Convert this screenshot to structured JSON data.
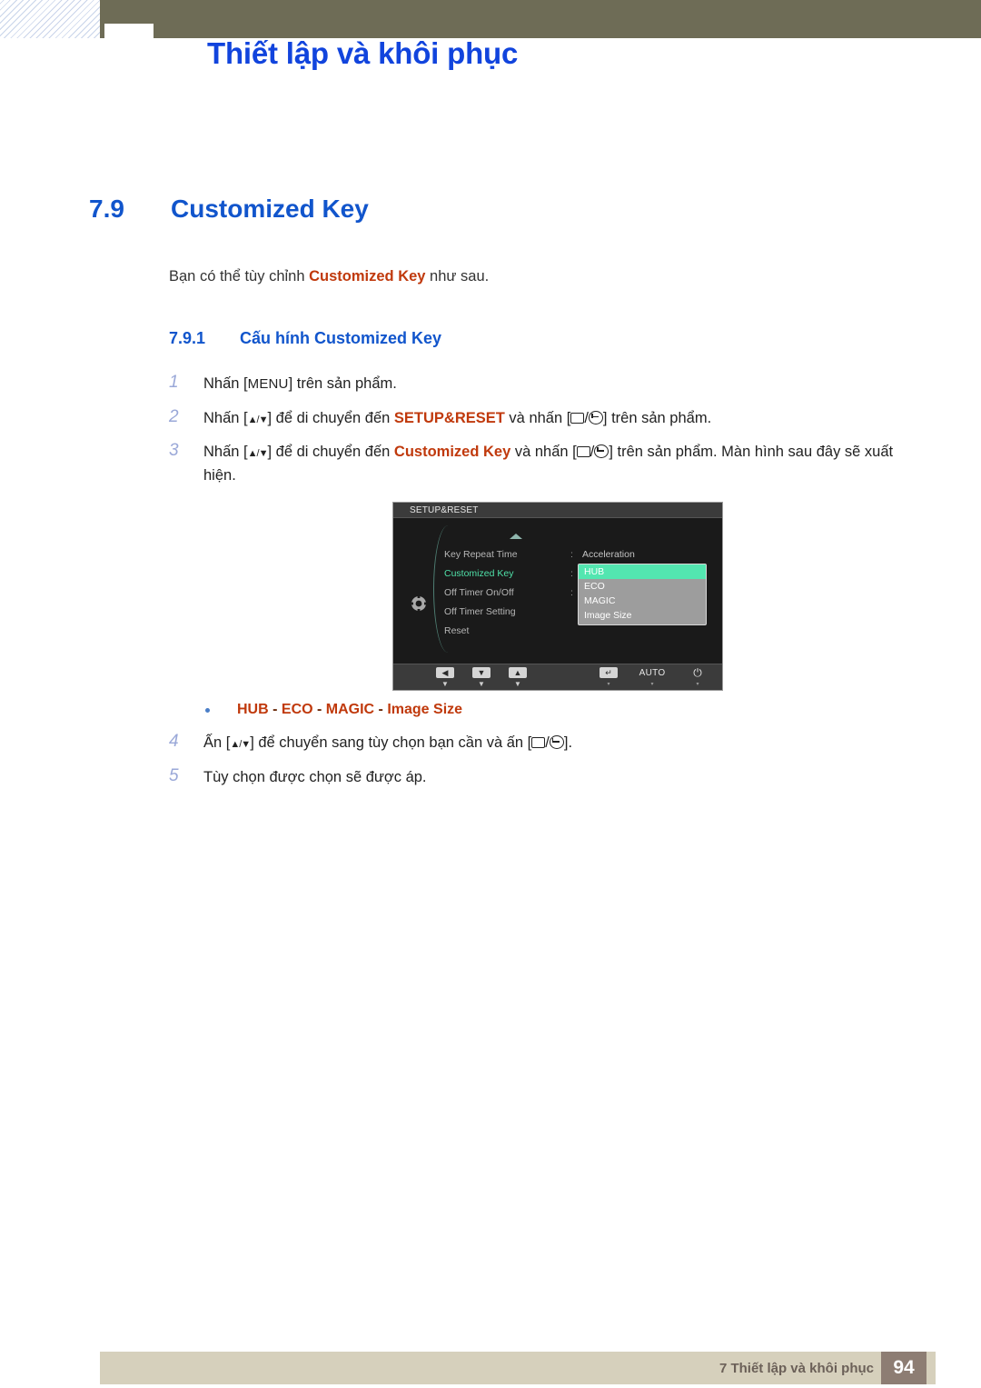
{
  "header": {
    "title": "Thiết lập và khôi phục"
  },
  "section": {
    "number": "7.9",
    "title": "Customized Key"
  },
  "intro": {
    "before": "Bạn có thể tùy chỉnh ",
    "emphasis": "Customized Key",
    "after": " như sau."
  },
  "subsection": {
    "number": "7.9.1",
    "title": "Cấu hính Customized Key"
  },
  "steps": [
    {
      "num": "1",
      "parts": [
        {
          "type": "text",
          "value": "Nhấn ["
        },
        {
          "type": "kbd",
          "value": "MENU"
        },
        {
          "type": "text",
          "value": "] trên sản phẩm."
        }
      ]
    },
    {
      "num": "2",
      "parts": [
        {
          "type": "text",
          "value": "Nhấn ["
        },
        {
          "type": "updown",
          "value": "▲/▼"
        },
        {
          "type": "text",
          "value": "] để di chuyển đến "
        },
        {
          "type": "emph",
          "value": "SETUP&RESET"
        },
        {
          "type": "text",
          "value": " và nhấn ["
        },
        {
          "type": "rect",
          "value": ""
        },
        {
          "type": "text",
          "value": "/"
        },
        {
          "type": "enter",
          "value": ""
        },
        {
          "type": "text",
          "value": "] trên sản phẩm."
        }
      ]
    },
    {
      "num": "3",
      "parts": [
        {
          "type": "text",
          "value": "Nhấn ["
        },
        {
          "type": "updown",
          "value": "▲/▼"
        },
        {
          "type": "text",
          "value": "] để di chuyển đến "
        },
        {
          "type": "emph",
          "value": "Customized Key"
        },
        {
          "type": "text",
          "value": " và nhấn ["
        },
        {
          "type": "rect",
          "value": ""
        },
        {
          "type": "text",
          "value": "/"
        },
        {
          "type": "enter",
          "value": ""
        },
        {
          "type": "text",
          "value": "] trên sản phẩm. Màn hình sau đây sẽ xuất hiện."
        }
      ]
    }
  ],
  "steps_after": [
    {
      "num": "4",
      "parts": [
        {
          "type": "text",
          "value": "Ấn ["
        },
        {
          "type": "updown",
          "value": "▲/▼"
        },
        {
          "type": "text",
          "value": "] để chuyển sang tùy chọn bạn cần và ấn ["
        },
        {
          "type": "rect",
          "value": ""
        },
        {
          "type": "text",
          "value": "/"
        },
        {
          "type": "enter",
          "value": ""
        },
        {
          "type": "text",
          "value": "]."
        }
      ]
    },
    {
      "num": "5",
      "parts": [
        {
          "type": "text",
          "value": "Tùy chọn được chọn sẽ được áp."
        }
      ]
    }
  ],
  "osd": {
    "title": "SETUP&RESET",
    "menu_items": [
      {
        "label": "Key Repeat Time",
        "active": false,
        "colon": ":",
        "value": "Acceleration"
      },
      {
        "label": "Customized Key",
        "active": true,
        "colon": ":",
        "value": ""
      },
      {
        "label": "Off Timer On/Off",
        "active": false,
        "colon": ":",
        "value": ""
      },
      {
        "label": "Off Timer Setting",
        "active": false,
        "colon": "",
        "value": ""
      },
      {
        "label": "Reset",
        "active": false,
        "colon": "",
        "value": ""
      }
    ],
    "popup_items": [
      {
        "label": "HUB",
        "selected": true
      },
      {
        "label": "ECO",
        "selected": false
      },
      {
        "label": "MAGIC",
        "selected": false
      },
      {
        "label": "Image Size",
        "selected": false
      }
    ],
    "buttons": [
      {
        "name": "left-arrow-button",
        "glyph": "◀",
        "kind": "key",
        "tick": "▼"
      },
      {
        "name": "down-arrow-button",
        "glyph": "▼",
        "kind": "key",
        "tick": "▼"
      },
      {
        "name": "up-arrow-button",
        "glyph": "▲",
        "kind": "key",
        "tick": "▼"
      },
      {
        "name": "enter-button",
        "glyph": "↵",
        "kind": "key",
        "tick": "▾"
      },
      {
        "name": "auto-button",
        "glyph": "AUTO",
        "kind": "text",
        "tick": "▾"
      },
      {
        "name": "power-button",
        "glyph": "⏻",
        "kind": "power",
        "tick": "▾"
      }
    ]
  },
  "bullet": {
    "items": [
      "HUB",
      "ECO",
      "MAGIC",
      "Image Size"
    ],
    "separator": " - "
  },
  "footer": {
    "text": "7 Thiết lập và khôi phục",
    "page": "94"
  },
  "colors": {
    "heading_blue": "#1155cc",
    "header_blue": "#1144dd",
    "emphasis_red": "#c0390c",
    "olive": "#6e6c56",
    "footer_beige": "#d6d0bc",
    "footer_brown": "#8d7d73",
    "osd_highlight": "#53e6b0",
    "step_number": "#9aa8d8"
  }
}
